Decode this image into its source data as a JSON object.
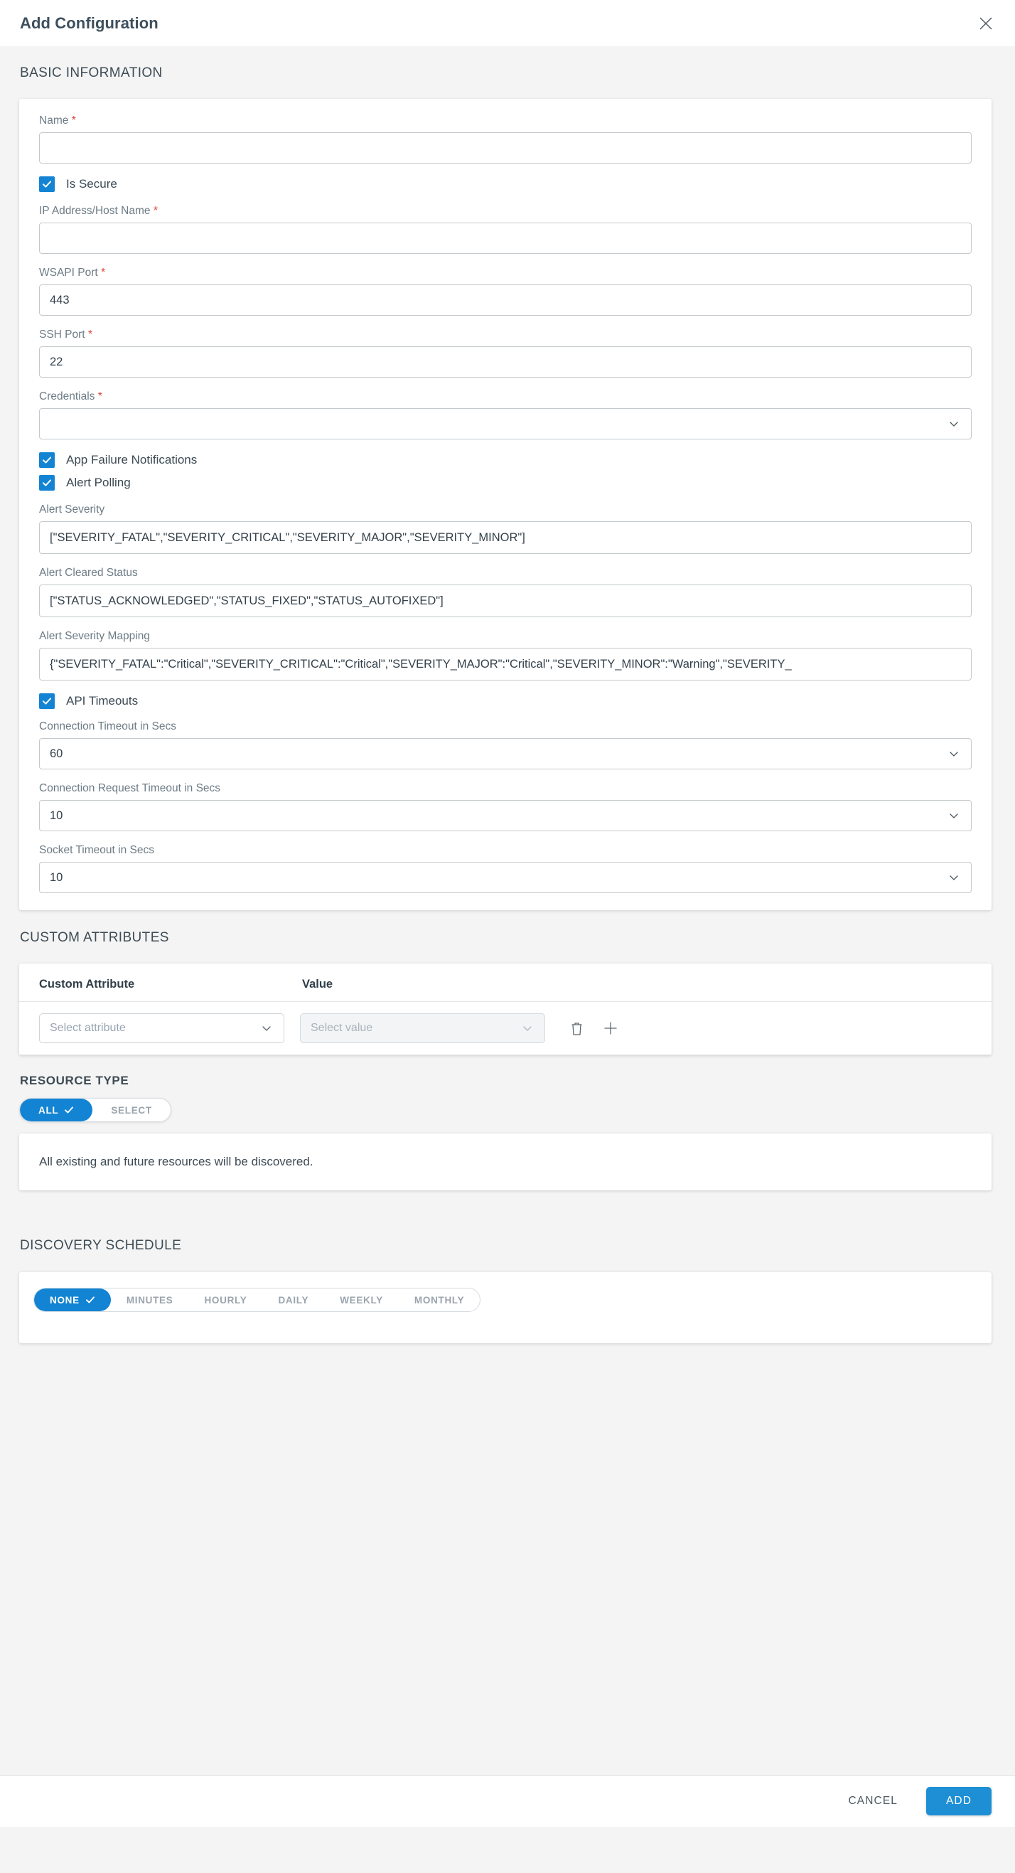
{
  "dialog": {
    "title": "Add Configuration",
    "close_icon": "close-icon"
  },
  "sections": {
    "basic_information": "BASIC INFORMATION",
    "custom_attributes": "CUSTOM ATTRIBUTES",
    "resource_type": "RESOURCE TYPE",
    "discovery_schedule": "DISCOVERY SCHEDULE"
  },
  "basic": {
    "name": {
      "label": "Name",
      "required": "*",
      "value": ""
    },
    "is_secure": {
      "label": "Is Secure",
      "checked": true
    },
    "ip_address": {
      "label": "IP Address/Host Name",
      "required": "*",
      "value": ""
    },
    "wsapi_port": {
      "label": "WSAPI Port",
      "required": "*",
      "value": "443"
    },
    "ssh_port": {
      "label": "SSH Port",
      "required": "*",
      "value": "22"
    },
    "credentials": {
      "label": "Credentials",
      "required": "*",
      "value": ""
    },
    "app_failure_notifications": {
      "label": "App Failure Notifications",
      "checked": true
    },
    "alert_polling": {
      "label": "Alert Polling",
      "checked": true
    },
    "alert_severity": {
      "label": "Alert Severity",
      "value": "[\"SEVERITY_FATAL\",\"SEVERITY_CRITICAL\",\"SEVERITY_MAJOR\",\"SEVERITY_MINOR\"]"
    },
    "alert_cleared_status": {
      "label": "Alert Cleared Status",
      "value": "[\"STATUS_ACKNOWLEDGED\",\"STATUS_FIXED\",\"STATUS_AUTOFIXED\"]"
    },
    "alert_severity_mapping": {
      "label": "Alert Severity Mapping",
      "value": "{\"SEVERITY_FATAL\":\"Critical\",\"SEVERITY_CRITICAL\":\"Critical\",\"SEVERITY_MAJOR\":\"Critical\",\"SEVERITY_MINOR\":\"Warning\",\"SEVERITY_"
    },
    "api_timeouts": {
      "label": "API Timeouts",
      "checked": true
    },
    "connection_timeout": {
      "label": "Connection Timeout in Secs",
      "value": "60"
    },
    "connection_request_timeout": {
      "label": "Connection Request Timeout in Secs",
      "value": "10"
    },
    "socket_timeout": {
      "label": "Socket Timeout in Secs",
      "value": "10"
    }
  },
  "custom_attributes": {
    "col_attribute": "Custom Attribute",
    "col_value": "Value",
    "attribute_placeholder": "Select attribute",
    "value_placeholder": "Select value",
    "delete_icon": "trash-icon",
    "add_icon": "plus-icon"
  },
  "resource_type": {
    "options": [
      "ALL",
      "SELECT"
    ],
    "selected": "ALL",
    "description": "All existing and future resources will be discovered."
  },
  "discovery_schedule": {
    "options": [
      "NONE",
      "MINUTES",
      "HOURLY",
      "DAILY",
      "WEEKLY",
      "MONTHLY"
    ],
    "selected": "NONE"
  },
  "footer": {
    "cancel": "CANCEL",
    "add": "ADD"
  },
  "colors": {
    "accent": "#1284d3",
    "add_button": "#1e8fd5",
    "required": "#e0433b",
    "body_bg": "#f4f4f4"
  }
}
